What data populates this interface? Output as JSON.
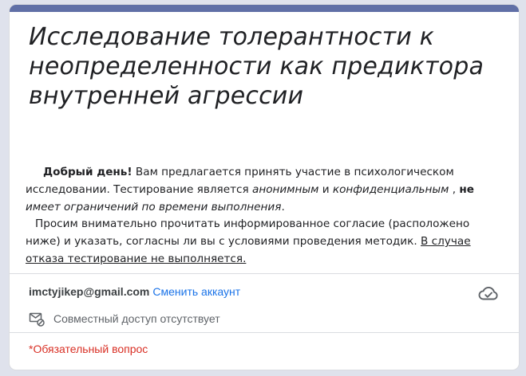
{
  "form": {
    "title": "Исследование толерантности к неопределенности как предиктора внутренней агрессии",
    "description": {
      "greeting_bold": "Добрый день!",
      "p1_a": " Вам предлагается принять участие в психологическом исследовании. Тестирование является ",
      "p1_italic1": "анонимным",
      "p1_b": " и ",
      "p1_italic2": "конфиденциальным",
      "p1_c": " , ",
      "p1_bold_ne": "не",
      "p1_italic3": " имеет ограничений по времени выполнения",
      "p1_d": ".",
      "p2_a": "Просим внимательно прочитать информированное согласие (расположено ниже) и указать, согласны ли вы с условиями проведения методик. ",
      "p2_underline": "В случае отказа тестирование не выполняется."
    }
  },
  "account": {
    "email": "imctyjikep@gmail.com",
    "switch_label": "Сменить аккаунт",
    "cloud_icon": "cloud-done-icon",
    "sharing_icon": "mail-blocked-icon",
    "sharing_text": "Совместный доступ отсутствует"
  },
  "required_note": "*Обязательный вопрос",
  "colors": {
    "accent": "#606fa6",
    "link": "#1a73e8",
    "required": "#d93025",
    "background": "#dfe2ec"
  }
}
